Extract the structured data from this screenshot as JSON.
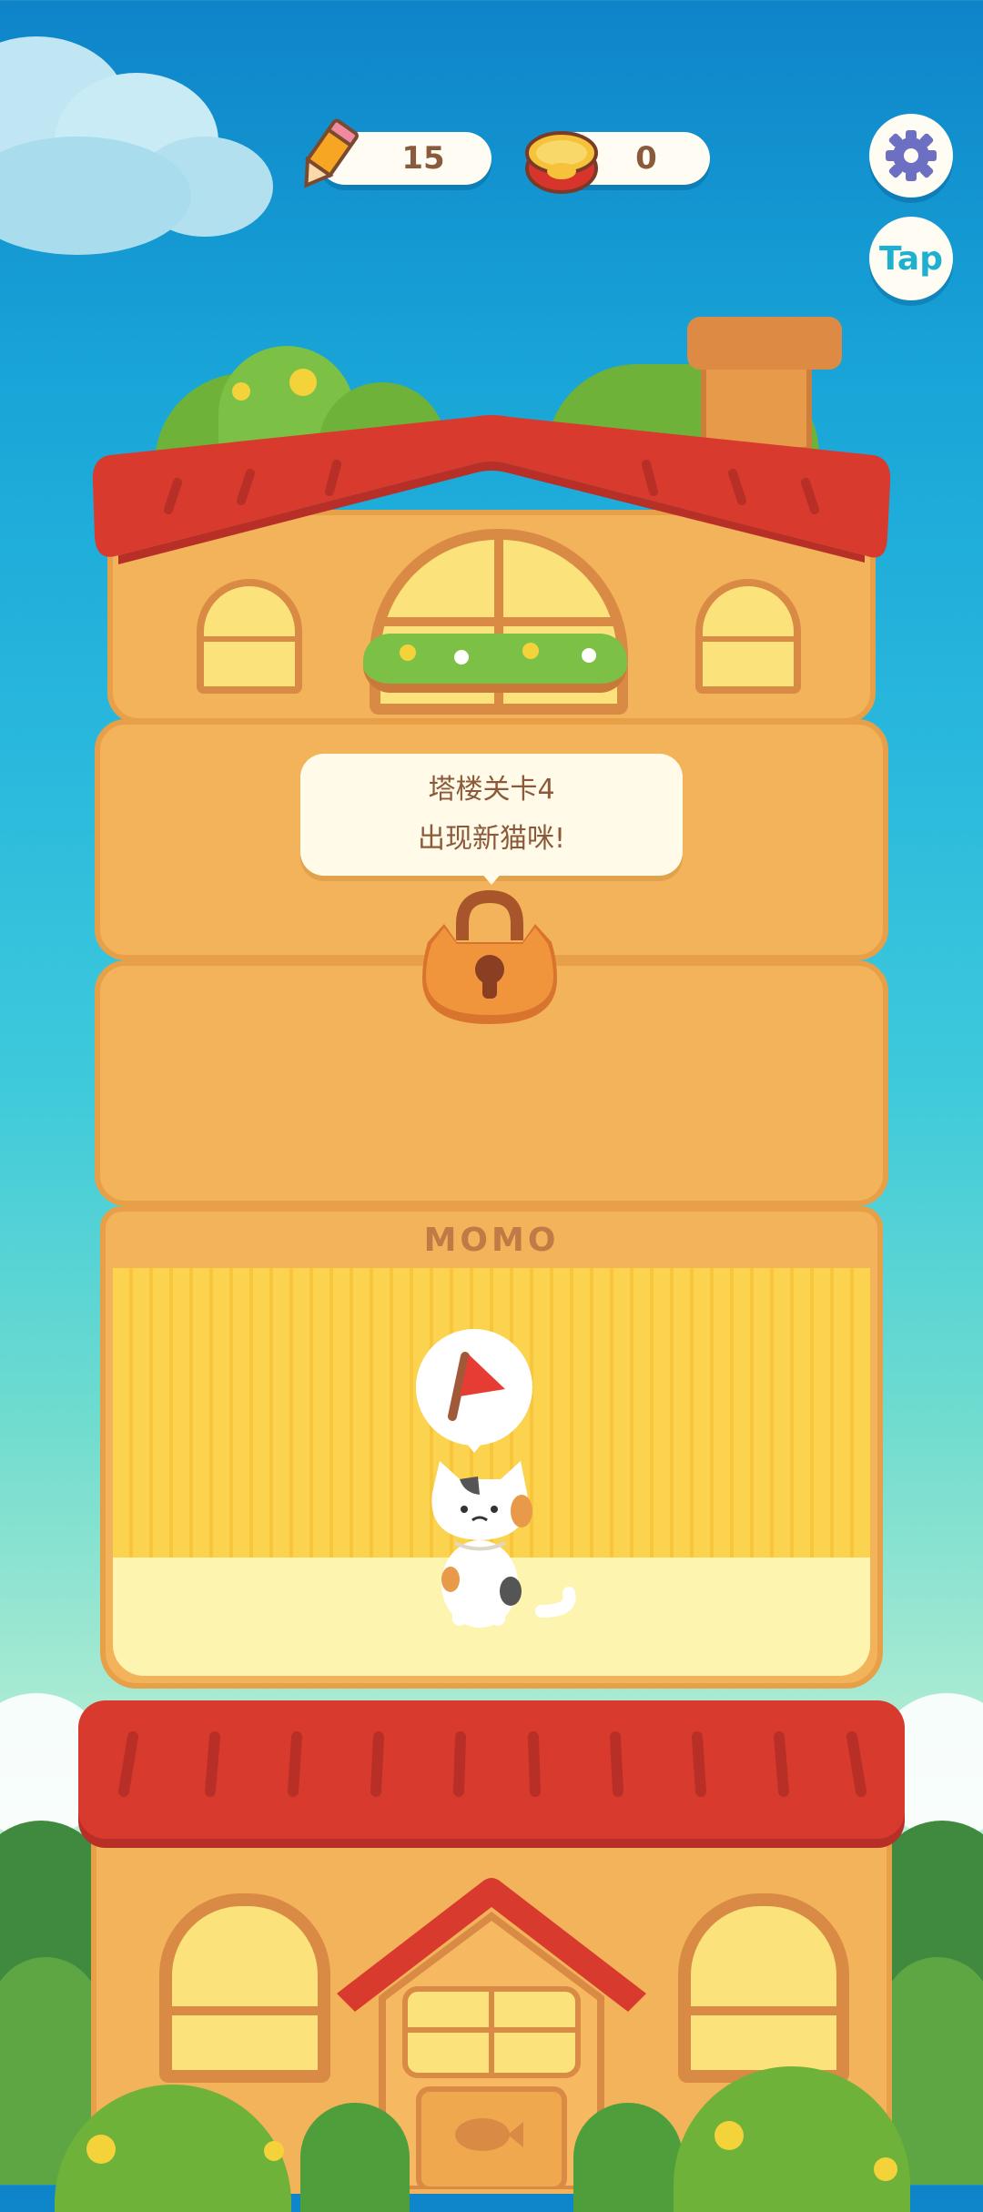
{
  "hud": {
    "pencil_count": "15",
    "can_count": "0",
    "tap_label": "Tap"
  },
  "tower": {
    "locked_floor_message_line1": "塔楼关卡4",
    "locked_floor_message_line2": "出现新猫咪!",
    "cat_room_sign": "MOMO"
  },
  "icons": {
    "pencil": "pencil-icon",
    "can": "fish-can-icon",
    "settings": "gear-icon",
    "lock": "padlock-icon",
    "flag": "red-flag-icon",
    "cat": "calico-cat"
  },
  "colors": {
    "roof_red": "#d93a2e",
    "wall_orange": "#f3b35a",
    "room_yellow": "#fbd34f",
    "accent_teal": "#1fb0cf"
  }
}
